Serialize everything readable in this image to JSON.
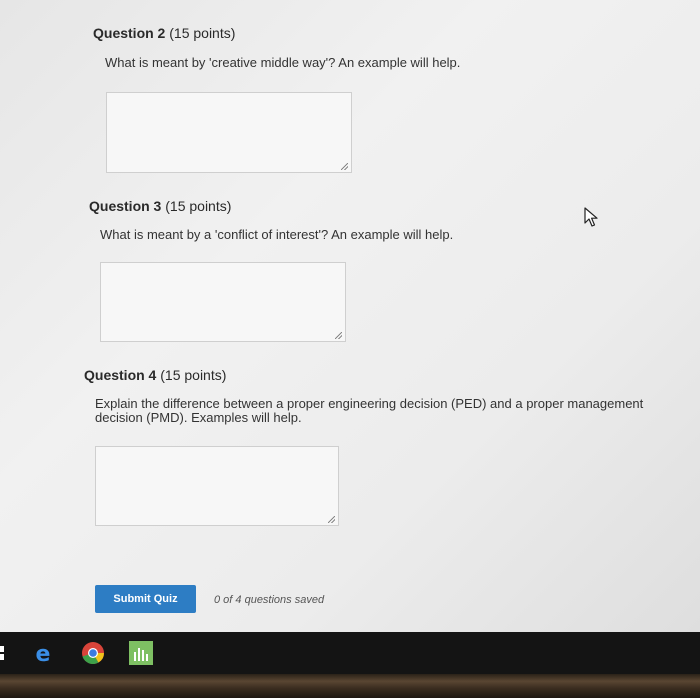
{
  "questions": [
    {
      "title": "Question 2",
      "points": "(15 points)",
      "text": "What is meant by 'creative middle way'? An example will help."
    },
    {
      "title": "Question 3",
      "points": "(15 points)",
      "text": "What is meant by a 'conflict of interest'? An example will help."
    },
    {
      "title": "Question 4",
      "points": "(15 points)",
      "text": "Explain the difference between a proper engineering decision (PED) and a proper management decision (PMD). Examples will help."
    }
  ],
  "answers": [
    "",
    "",
    ""
  ],
  "footer": {
    "submit_label": "Submit Quiz",
    "saved_status": "0 of 4 questions saved"
  },
  "taskbar": {
    "icons": [
      "windows-start-icon",
      "edge-browser-icon",
      "chrome-browser-icon",
      "app-chart-icon"
    ]
  },
  "colors": {
    "accent": "#2d7dc4",
    "taskbar": "#141414"
  }
}
